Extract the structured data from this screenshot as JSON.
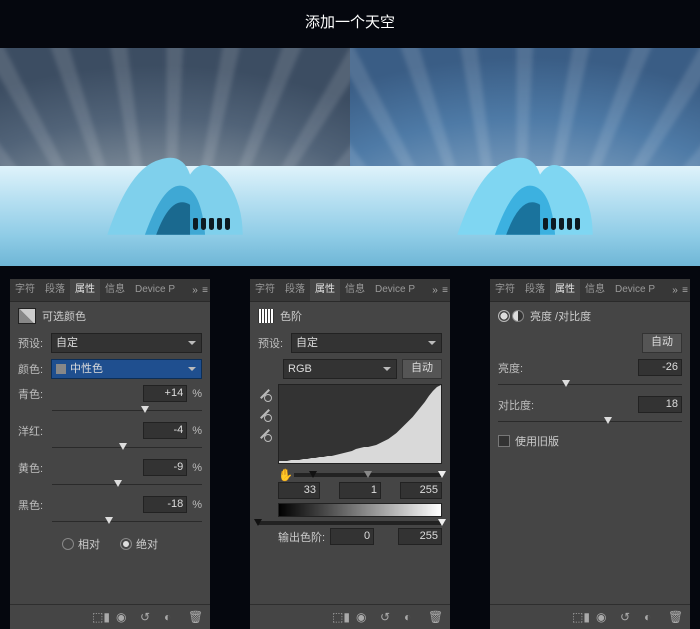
{
  "title": "添加一个天空",
  "tabs": {
    "t1": "字符",
    "t2": "段落",
    "t3": "属性",
    "t4": "信息",
    "t5": "Device P"
  },
  "panel1": {
    "name": "可选颜色",
    "preset_label": "预设:",
    "preset_value": "自定",
    "color_label": "颜色:",
    "color_value": "中性色",
    "rows": [
      {
        "label": "青色:",
        "value": "+14",
        "unit": "%",
        "pos": 62
      },
      {
        "label": "洋红:",
        "value": "-4",
        "unit": "%",
        "pos": 47
      },
      {
        "label": "黄色:",
        "value": "-9",
        "unit": "%",
        "pos": 44
      },
      {
        "label": "黑色:",
        "value": "-18",
        "unit": "%",
        "pos": 38
      }
    ],
    "radio1": "相对",
    "radio2": "绝对"
  },
  "panel2": {
    "name": "色阶",
    "preset_label": "预设:",
    "preset_value": "自定",
    "channel": "RGB",
    "auto": "自动",
    "in": [
      33,
      1.0,
      255
    ],
    "out_label": "输出色阶:",
    "out": [
      0,
      255
    ]
  },
  "panel3": {
    "name": "亮度 /对比度",
    "auto": "自动",
    "bright_label": "亮度:",
    "bright_value": "-26",
    "bright_pos": 37,
    "contrast_label": "对比度:",
    "contrast_value": "18",
    "contrast_pos": 60,
    "legacy": "使用旧版"
  },
  "chart_data": {
    "type": "area",
    "title": "Levels Histogram",
    "xlabel": "",
    "ylabel": "",
    "xlim": [
      0,
      255
    ],
    "values": [
      1,
      1,
      1,
      1,
      1,
      1,
      1,
      1,
      1,
      2,
      2,
      2,
      2,
      2,
      2,
      2,
      3,
      3,
      3,
      3,
      3,
      3,
      4,
      4,
      4,
      4,
      5,
      5,
      5,
      5,
      6,
      6,
      6,
      7,
      7,
      8,
      8,
      8,
      9,
      10,
      12,
      14,
      13,
      12,
      12,
      12,
      13,
      14,
      15,
      15,
      15,
      16,
      16,
      17,
      18,
      20,
      23,
      28,
      36,
      48,
      64,
      78,
      70,
      55
    ],
    "input_levels": {
      "shadow": 33,
      "mid": 1.0,
      "highlight": 255
    },
    "output_levels": {
      "low": 0,
      "high": 255
    }
  }
}
